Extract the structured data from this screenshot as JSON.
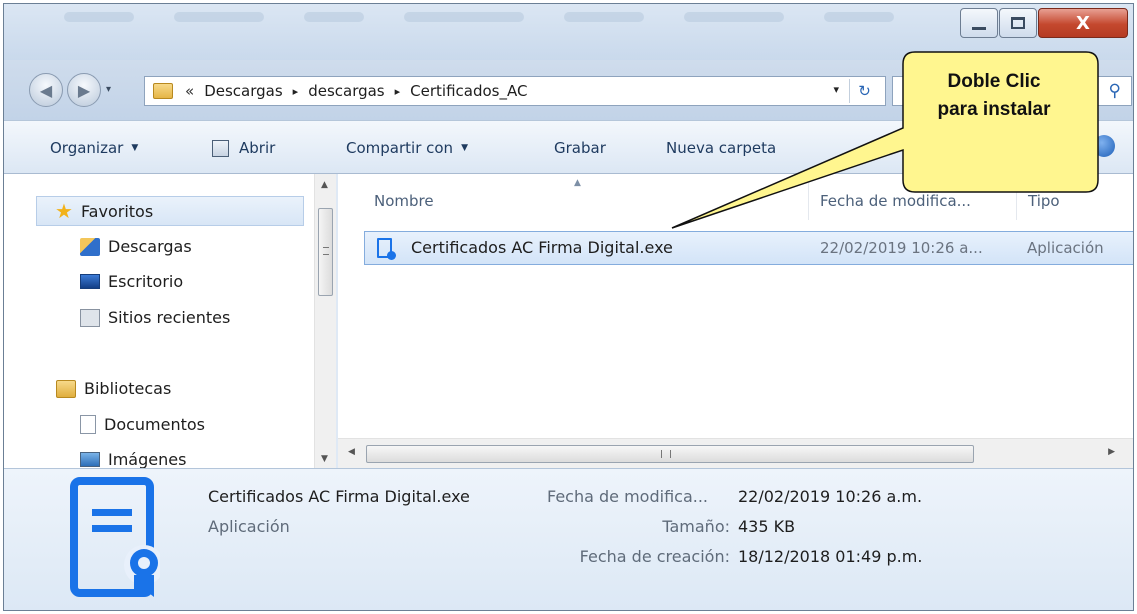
{
  "window": {
    "minimize_glyph": "",
    "close_glyph": "X"
  },
  "address": {
    "overflow_chevrons": "«",
    "crumbs": [
      "Descargas",
      "descargas",
      "Certificados_AC"
    ],
    "separator": "▸",
    "dropdown_glyph": "▾",
    "refresh_glyph": "↻"
  },
  "search": {
    "icon": "search-icon"
  },
  "commands": {
    "organizar": "Organizar",
    "abrir": "Abrir",
    "compartir": "Compartir con",
    "grabar": "Grabar",
    "nueva_carpeta": "Nueva carpeta"
  },
  "nav": {
    "favoritos": "Favoritos",
    "descargas": "Descargas",
    "escritorio": "Escritorio",
    "sitios_recientes": "Sitios recientes",
    "bibliotecas": "Bibliotecas",
    "documentos": "Documentos",
    "imagenes": "Imágenes"
  },
  "columns": {
    "nombre": "Nombre",
    "fecha": "Fecha de modifica...",
    "tipo": "Tipo"
  },
  "files": [
    {
      "name": "Certificados AC Firma Digital.exe",
      "date": "22/02/2019 10:26 a...",
      "type": "Aplicación"
    }
  ],
  "details": {
    "name": "Certificados AC Firma Digital.exe",
    "type": "Aplicación",
    "label_modified": "Fecha de modifica...",
    "value_modified": "22/02/2019 10:26 a.m.",
    "label_size": "Tamaño:",
    "value_size": "435 KB",
    "label_created": "Fecha de creación:",
    "value_created": "18/12/2018 01:49 p.m."
  },
  "callout": {
    "line1": "Doble Clic",
    "line2": "para instalar",
    "fill": "#fff68f"
  },
  "colors": {
    "accent": "#1a73e8",
    "selection": "#d3e4f8"
  }
}
